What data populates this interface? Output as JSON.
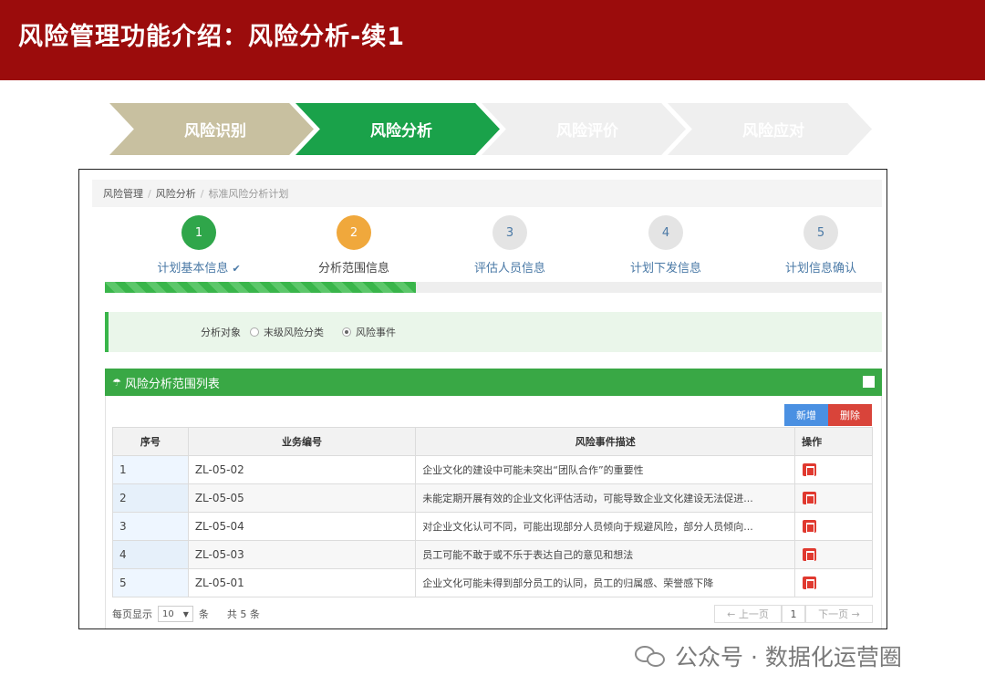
{
  "slide": {
    "title": "风险管理功能介绍：风险分析-续1",
    "banner_color": "#9b0c0c"
  },
  "chevrons": [
    {
      "label": "风险识别",
      "color": "#c8c0a0",
      "active": false
    },
    {
      "label": "风险分析",
      "color": "#1aa24a",
      "active": true
    },
    {
      "label": "风险评价",
      "color": "#efefef",
      "active": false
    },
    {
      "label": "风险应对",
      "color": "#efefef",
      "active": false
    }
  ],
  "breadcrumb": {
    "items": [
      "风险管理",
      "风险分析"
    ],
    "current": "标准风险分析计划"
  },
  "steps": [
    {
      "number": "1",
      "label": "计划基本信息",
      "state": "done",
      "color": "#2fa64a",
      "check_icon": "check-icon"
    },
    {
      "number": "2",
      "label": "分析范围信息",
      "state": "current",
      "color": "#f0a83c"
    },
    {
      "number": "3",
      "label": "评估人员信息",
      "state": "pending",
      "color": "#e4e4e4"
    },
    {
      "number": "4",
      "label": "计划下发信息",
      "state": "pending",
      "color": "#e4e4e4"
    },
    {
      "number": "5",
      "label": "计划信息确认",
      "state": "pending",
      "color": "#e4e4e4"
    }
  ],
  "progress_fraction": 0.4,
  "filter": {
    "label": "分析对象",
    "options": [
      {
        "label": "末级风险分类",
        "selected": false
      },
      {
        "label": "风险事件",
        "selected": true
      }
    ]
  },
  "panel": {
    "title": "风险分析范围列表",
    "icon": "umbrella-icon",
    "add_label": "新增",
    "delete_label": "删除"
  },
  "table": {
    "headers": [
      "序号",
      "业务编号",
      "风险事件描述",
      "操作"
    ],
    "rows": [
      {
        "idx": "1",
        "code": "ZL-05-02",
        "desc": "企业文化的建设中可能未突出“团队合作”的重要性"
      },
      {
        "idx": "2",
        "code": "ZL-05-05",
        "desc": "未能定期开展有效的企业文化评估活动，可能导致企业文化建设无法促进..."
      },
      {
        "idx": "3",
        "code": "ZL-05-04",
        "desc": "对企业文化认可不同，可能出现部分人员倾向于规避风险，部分人员倾向..."
      },
      {
        "idx": "4",
        "code": "ZL-05-03",
        "desc": "员工可能不敢于或不乐于表达自己的意见和想法"
      },
      {
        "idx": "5",
        "code": "ZL-05-01",
        "desc": "企业文化可能未得到部分员工的认同，员工的归属感、荣誉感下降"
      }
    ]
  },
  "pager": {
    "per_page_label": "每页显示",
    "per_page_value": "10",
    "unit_label": "条",
    "total_label": "共 5 条",
    "prev_label": "← 上一页",
    "current_page": "1",
    "next_label": "下一页 →"
  },
  "watermark": {
    "text": "公众号 · 数据化运营圈",
    "icon": "wechat-icon"
  }
}
